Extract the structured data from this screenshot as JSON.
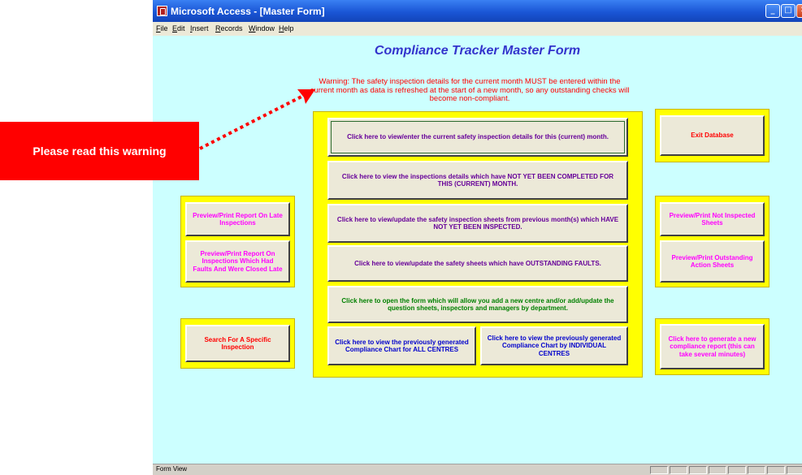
{
  "window": {
    "title": "Microsoft Access - [Master Form]",
    "controls": {
      "minimize": "_",
      "maximize": "□",
      "close": "✕"
    }
  },
  "menu": [
    "File",
    "Edit",
    "Insert",
    "Records",
    "Window",
    "Help"
  ],
  "form": {
    "title": "Compliance Tracker Master Form",
    "warning": "Warning: The safety inspection details for the current month MUST be entered within the current month as data is refreshed at the start of a new month, so any outstanding checks will become non-compliant.",
    "center_buttons": {
      "current_month": "Click here to view/enter the current safety inspection details for this (current) month.",
      "not_completed": "Click here to view the inspections details which have NOT YET BEEN COMPLETED FOR THIS (CURRENT) MONTH.",
      "previous_months": "Click here to view/update the safety inspection sheets from previous month(s) which HAVE NOT YET BEEN INSPECTED.",
      "outstanding_faults": "Click here to view/update the safety sheets which have OUTSTANDING FAULTS.",
      "add_centre": "Click here to open the form which will allow you add a new centre and/or add/update the question sheets, inspectors and managers by department.",
      "chart_all": "Click here to view the previously generated Compliance Chart for ALL CENTRES",
      "chart_individual": "Click here to view the previously generated Compliance Chart by INDIVIDUAL CENTRES"
    },
    "left_buttons": {
      "late_inspections": "Preview/Print Report On Late Inspections",
      "faults_closed_late": "Preview/Print Report On Inspections Which Had Faults And Were Closed Late",
      "search": "Search For A Specific Inspection"
    },
    "right_buttons": {
      "exit": "Exit Database",
      "not_inspected": "Preview/Print Not Inspected Sheets",
      "outstanding_action": "Preview/Print Outstanding Action Sheets",
      "generate_report": "Click here to generate  a new compliance report (this can take several minutes)"
    }
  },
  "callout": {
    "text": "Please read this warning"
  },
  "status": {
    "text": "Form View"
  },
  "colors": {
    "form_bg": "#ccffff",
    "panel": "#ffff00",
    "title": "#3333cc",
    "warning": "#ff0000",
    "callout": "#ff0000"
  }
}
